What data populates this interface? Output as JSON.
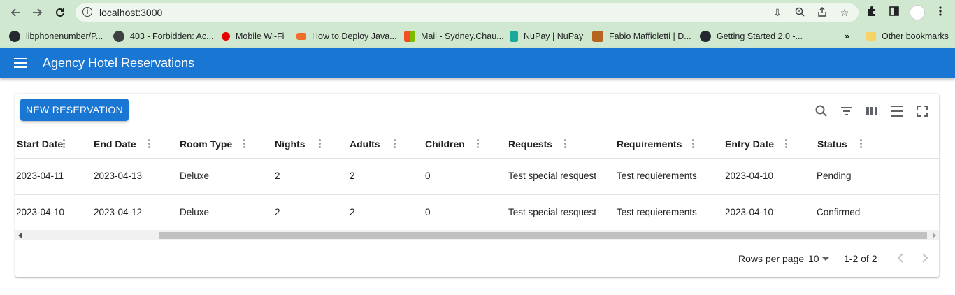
{
  "browser": {
    "url": "localhost:3000",
    "bookmarks": [
      {
        "label": "libphonenumber/P...",
        "icon": "github-icon"
      },
      {
        "label": "403 - Forbidden: Ac...",
        "icon": "globe-icon"
      },
      {
        "label": "Mobile Wi-Fi",
        "icon": "vodafone-icon"
      },
      {
        "label": "How to Deploy Java...",
        "icon": "cp-icon"
      },
      {
        "label": "Mail - Sydney.Chau...",
        "icon": "microsoft-icon"
      },
      {
        "label": "NuPay | NuPay",
        "icon": "nupay-icon"
      },
      {
        "label": "Fabio Maffioletti | D...",
        "icon": "photo-icon"
      },
      {
        "label": "Getting Started 2.0 -...",
        "icon": "github-icon"
      }
    ],
    "more_bookmarks": "»",
    "other_bookmarks": "Other bookmarks"
  },
  "app": {
    "title": "Agency Hotel Reservations",
    "primary_color": "#1976d2"
  },
  "toolbar": {
    "new_reservation_label": "NEW RESERVATION",
    "icons": [
      "search-icon",
      "filter-icon",
      "columns-icon",
      "density-icon",
      "fullscreen-icon"
    ]
  },
  "table": {
    "columns": [
      "Start Date",
      "End Date",
      "Room Type",
      "Nights",
      "Adults",
      "Children",
      "Requests",
      "Requirements",
      "Entry Date",
      "Status"
    ],
    "rows": [
      [
        "2023-04-11",
        "2023-04-13",
        "Deluxe",
        "2",
        "2",
        "0",
        "Test special resquest",
        "Test requierements",
        "2023-04-10",
        "Pending"
      ],
      [
        "2023-04-10",
        "2023-04-12",
        "Deluxe",
        "2",
        "2",
        "0",
        "Test special resquest",
        "Test requierements",
        "2023-04-10",
        "Confirmed"
      ]
    ]
  },
  "pagination": {
    "rows_per_page_label": "Rows per page",
    "rows_per_page_value": "10",
    "range_text": "1-2 of 2"
  }
}
